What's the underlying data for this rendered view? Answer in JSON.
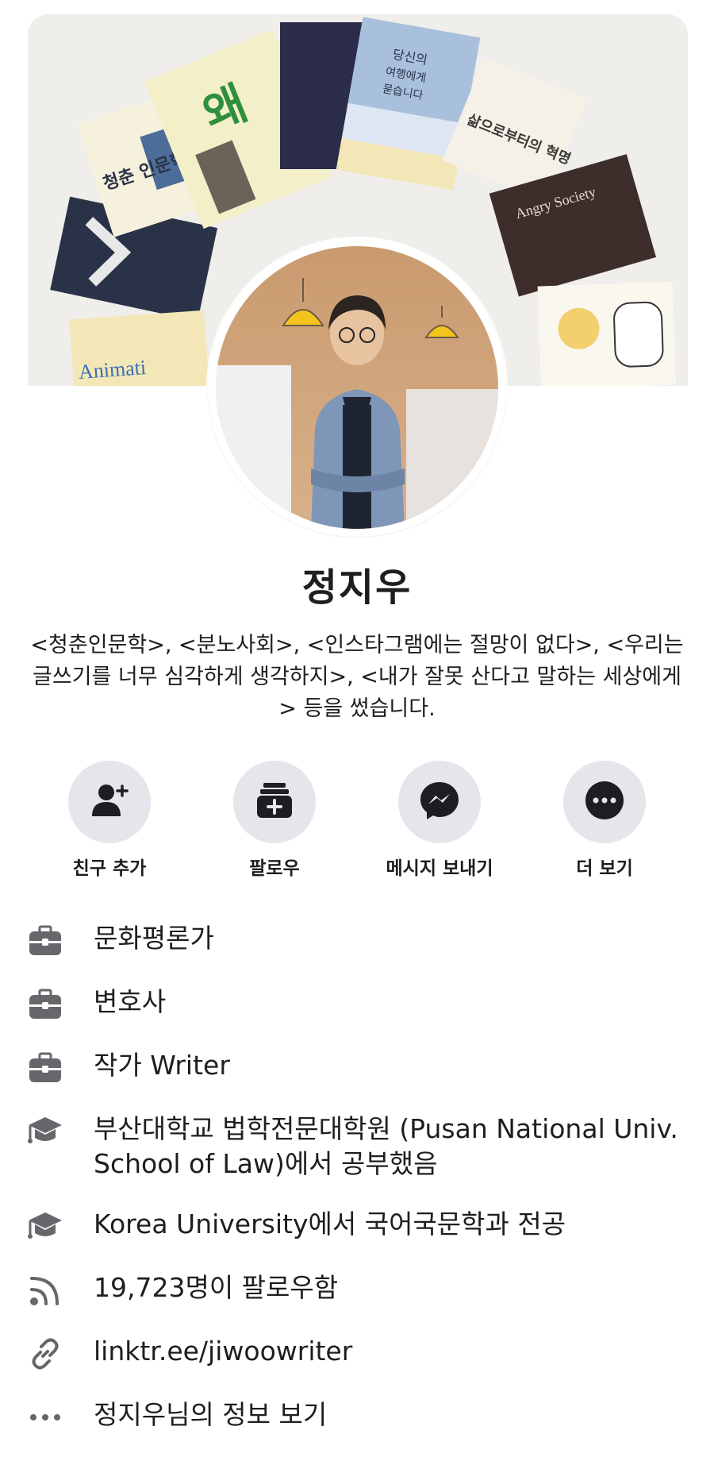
{
  "cover": {
    "book_titles": [
      "왜",
      "청춘 인문학",
      "당신의 여행에게 묻습니다",
      "삶으로부터의 혁명",
      "Angry Society",
      "Animati"
    ]
  },
  "profile": {
    "name": "정지우",
    "bio": "<청춘인문학>, <분노사회>, <인스타그램에는 절망이 없다>, <우리는 글쓰기를 너무 심각하게 생각하지>, <내가 잘못 산다고 말하는 세상에게> 등을 썼습니다."
  },
  "actions": [
    {
      "label": "친구 추가",
      "icon": "add-friend-icon"
    },
    {
      "label": "팔로우",
      "icon": "follow-icon"
    },
    {
      "label": "메시지 보내기",
      "icon": "messenger-icon"
    },
    {
      "label": "더 보기",
      "icon": "more-icon"
    }
  ],
  "info": [
    {
      "text": "문화평론가",
      "icon": "briefcase-icon"
    },
    {
      "text": "변호사",
      "icon": "briefcase-icon"
    },
    {
      "text": "작가 Writer",
      "icon": "briefcase-icon"
    },
    {
      "text": "부산대학교 법학전문대학원 (Pusan National Univ. School of Law)에서 공부했음",
      "icon": "graduation-cap-icon"
    },
    {
      "text": "Korea University에서 국어국문학과 전공",
      "icon": "graduation-cap-icon"
    },
    {
      "text": "19,723명이 팔로우함",
      "icon": "rss-icon"
    },
    {
      "text": "linktr.ee/jiwoowriter",
      "icon": "link-icon"
    },
    {
      "text": "정지우님의 정보 보기",
      "icon": "ellipsis-icon"
    }
  ],
  "colors": {
    "text": "#1c1e21",
    "icon_gray": "#65676b",
    "button_bg": "#e4e6eb"
  }
}
